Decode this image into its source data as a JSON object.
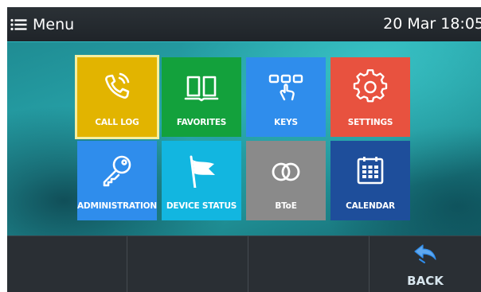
{
  "header": {
    "menu_label": "Menu",
    "datetime": "20 Mar 18:05",
    "menu_icon": "hamburger-icon"
  },
  "tiles": [
    {
      "label": "CALL LOG",
      "icon": "phone-icon",
      "color": "#e2b400",
      "selected": true
    },
    {
      "label": "FAVORITES",
      "icon": "book-icon",
      "color": "#13a13c"
    },
    {
      "label": "KEYS",
      "icon": "keys-icon",
      "color": "#2f8dec"
    },
    {
      "label": "SETTINGS",
      "icon": "gear-icon",
      "color": "#e8523f"
    },
    {
      "label": "ADMINISTRATION",
      "icon": "key-icon",
      "color": "#2f8dec"
    },
    {
      "label": "DEVICE STATUS",
      "icon": "flag-icon",
      "color": "#12b6e0"
    },
    {
      "label": "BToE",
      "icon": "rings-icon",
      "color": "#8a8a8a"
    },
    {
      "label": "CALENDAR",
      "icon": "calendar-icon",
      "color": "#1e4e9b"
    }
  ],
  "softkeys": {
    "back_label": "BACK",
    "back_icon": "back-arrow-icon",
    "accent_color": "#2f8dec"
  }
}
